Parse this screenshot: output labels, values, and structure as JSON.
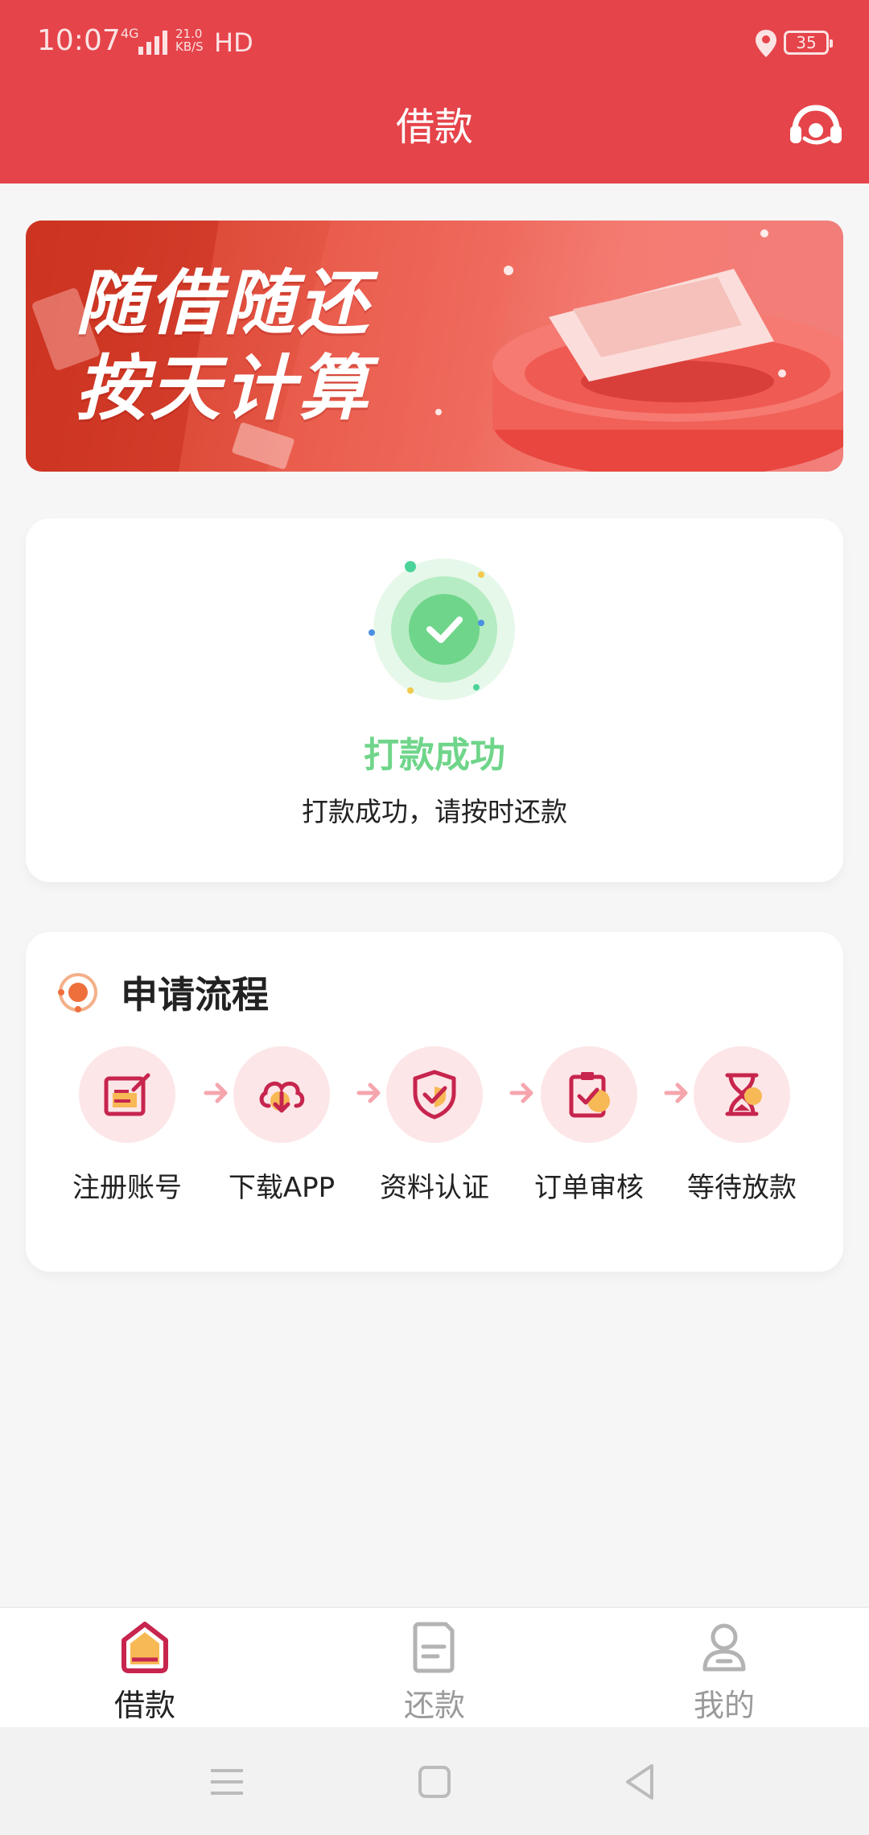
{
  "status_bar": {
    "time": "10:07",
    "network_type": "4G",
    "speed_value": "21.0",
    "speed_unit": "KB/S",
    "hd": "HD",
    "battery": "35"
  },
  "header": {
    "title": "借款",
    "background_color": "#e5444a"
  },
  "banner": {
    "line1": "随借随还",
    "line2": "按天计算"
  },
  "status_card": {
    "title": "打款成功",
    "description": "打款成功，请按时还款",
    "accent_color": "#6fd58a",
    "icon": "check-circle-icon"
  },
  "process": {
    "title": "申请流程",
    "steps": [
      {
        "label": "注册账号",
        "icon": "register-form-icon"
      },
      {
        "label": "下载APP",
        "icon": "cloud-download-icon"
      },
      {
        "label": "资料认证",
        "icon": "shield-check-icon"
      },
      {
        "label": "订单审核",
        "icon": "clipboard-check-icon"
      },
      {
        "label": "等待放款",
        "icon": "hourglass-icon"
      }
    ]
  },
  "bottom_nav": {
    "items": [
      {
        "label": "借款",
        "icon": "home-icon",
        "active": true
      },
      {
        "label": "还款",
        "icon": "document-icon",
        "active": false
      },
      {
        "label": "我的",
        "icon": "user-icon",
        "active": false
      }
    ]
  }
}
